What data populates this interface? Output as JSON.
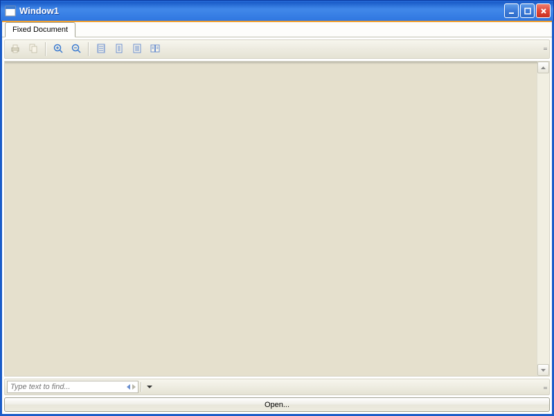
{
  "window": {
    "title": "Window1"
  },
  "tabs": [
    {
      "label": "Fixed Document"
    }
  ],
  "find": {
    "placeholder": "Type text to find..."
  },
  "buttons": {
    "open": "Open..."
  }
}
